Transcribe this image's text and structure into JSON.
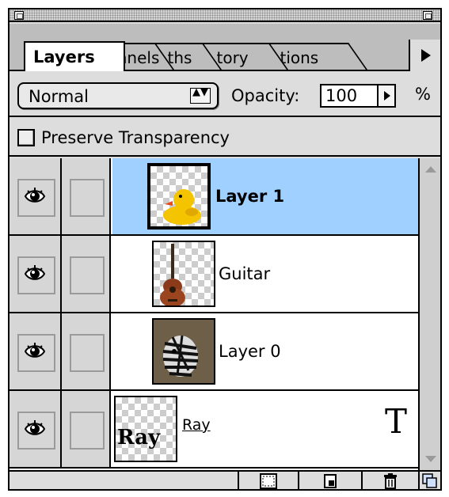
{
  "tabs": [
    {
      "label": "Layers",
      "active": true
    },
    {
      "label": "annels"
    },
    {
      "label": "ths"
    },
    {
      "label": "tory"
    },
    {
      "label": "tions"
    }
  ],
  "blend": {
    "mode": "Normal",
    "arrows": "▲▼"
  },
  "opacity": {
    "label": "Opacity:",
    "value": "100",
    "unit": "%"
  },
  "preserve": {
    "label": "Preserve Transparency",
    "checked": false
  },
  "layers": [
    {
      "name": "Layer 1",
      "selected": true,
      "visible": true,
      "paint_brush": true,
      "thumbnail": "rubber-duck"
    },
    {
      "name": "Guitar",
      "selected": false,
      "visible": true,
      "thumbnail": "guitar"
    },
    {
      "name": "Layer 0",
      "selected": false,
      "visible": true,
      "thumbnail": "zebra"
    },
    {
      "name": "Ray",
      "selected": false,
      "visible": true,
      "thumbnail": "text-ray",
      "thumb_text": "Ray",
      "type_glyph": "T"
    }
  ],
  "colors": {
    "selection": "#9fd0ff",
    "panel": "#dddddd"
  },
  "icons": [
    "close-box-icon",
    "zoom-box-icon",
    "palette-menu-icon",
    "eye-icon",
    "paintbrush-icon",
    "layer-mask-icon",
    "new-layer-icon",
    "trash-icon",
    "resize-icon"
  ]
}
